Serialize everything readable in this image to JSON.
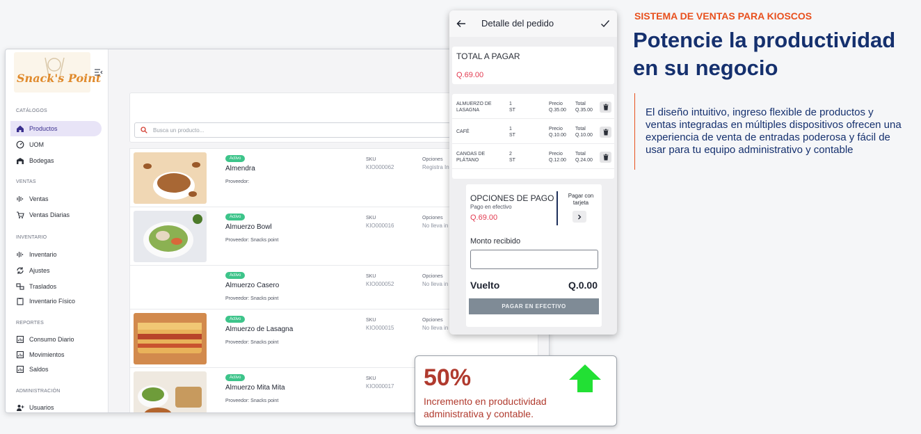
{
  "marketing": {
    "eyebrow": "SISTEMA DE VENTAS PARA KIOSCOS",
    "headline": "Potencie la productividad en su negocio",
    "description": "El diseño intuitivo, ingreso flexible de productos y ventas integradas en múltiples dispositivos ofrecen una experiencia de venta de entradas poderosa y fácil de usar para tu equipo administrativo y contable"
  },
  "app": {
    "logo_text": "Snack's Point",
    "sidebar": {
      "sections": [
        {
          "title": "CATÁLOGOS",
          "items": [
            {
              "label": "Productos",
              "icon": "home-icon",
              "active": true
            },
            {
              "label": "UOM",
              "icon": "gauge-icon"
            },
            {
              "label": "Bodegas",
              "icon": "warehouse-icon"
            }
          ]
        },
        {
          "title": "VENTAS",
          "items": [
            {
              "label": "Ventas",
              "icon": "bars-icon"
            },
            {
              "label": "Ventas Diarias",
              "icon": "cart-icon"
            }
          ]
        },
        {
          "title": "INVENTARIO",
          "items": [
            {
              "label": "Inventario",
              "icon": "bars-icon"
            },
            {
              "label": "Ajustes",
              "icon": "sync-icon"
            },
            {
              "label": "Traslados",
              "icon": "transfer-icon"
            },
            {
              "label": "Inventario Físico",
              "icon": "clipboard-icon"
            }
          ]
        },
        {
          "title": "REPORTES",
          "items": [
            {
              "label": "Consumo Diario",
              "icon": "report-icon"
            },
            {
              "label": "Movimientos",
              "icon": "report-icon"
            },
            {
              "label": "Saldos",
              "icon": "report-icon"
            }
          ]
        },
        {
          "title": "ADMINISTRACIÓN",
          "items": [
            {
              "label": "Usuarios",
              "icon": "add-user-icon"
            }
          ]
        }
      ]
    },
    "search": {
      "placeholder": "Busca un producto..."
    },
    "products": [
      {
        "status": "Activo",
        "name": "Almendra",
        "provider": "Proveedor:",
        "sku_label": "SKU",
        "sku": "KIO000062",
        "options_label": "Opciones",
        "options": "Registra In",
        "image": "almonds"
      },
      {
        "status": "Activo",
        "name": "Almuerzo Bowl",
        "provider": "Proveedor: Snacks point",
        "sku_label": "SKU",
        "sku": "KIO000016",
        "options_label": "Opciones",
        "options": "No lleva in",
        "image": "bowl"
      },
      {
        "status": "Activo",
        "name": "Almuerzo Casero",
        "provider": "Proveedor: Snacks point",
        "sku_label": "SKU",
        "sku": "KIO000052",
        "options_label": "Opciones",
        "options": "No lleva in",
        "image": ""
      },
      {
        "status": "Activo",
        "name": "Almuerzo de Lasagna",
        "provider": "Proveedor: Snacks point",
        "sku_label": "SKU",
        "sku": "KIO000015",
        "options_label": "Opciones",
        "options": "No lleva in",
        "image": "lasagna"
      },
      {
        "status": "Activo",
        "name": "Almuerzo Mita Mita",
        "provider": "Proveedor: Snacks point",
        "sku_label": "SKU",
        "sku": "KIO000017",
        "options_label": "",
        "options": "",
        "image": "salad"
      }
    ]
  },
  "order": {
    "title": "Detalle del pedido",
    "total_label": "TOTAL A PAGAR",
    "total_value": "Q.69.00",
    "items": [
      {
        "name_l1": "ALMUERZO DE",
        "name_l2": "LASAGNA",
        "qty": "1",
        "unit": "ST",
        "price_label": "Precio",
        "price": "Q.35.00",
        "total_label": "Total",
        "total": "Q.35.00"
      },
      {
        "name_l1": "CAFÉ",
        "name_l2": "",
        "qty": "1",
        "unit": "ST",
        "price_label": "Precio",
        "price": "Q.10.00",
        "total_label": "Total",
        "total": "Q.10.00"
      },
      {
        "name_l1": "CANOAS DE",
        "name_l2": "PLÁTANO",
        "qty": "2",
        "unit": "ST",
        "price_label": "Precio",
        "price": "Q.12.00",
        "total_label": "Total",
        "total": "Q.24.00"
      }
    ],
    "payment": {
      "title": "OPCIONES DE PAGO",
      "subtitle": "Pago en efectivo",
      "amount": "Q.69.00",
      "card_label_l1": "Pagar con",
      "card_label_l2": "tarjeta",
      "received_label": "Monto recibido",
      "received_value": "",
      "change_label": "Vuelto",
      "change_value": "Q.0.00",
      "pay_button": "PAGAR EN EFECTIVO"
    }
  },
  "stat": {
    "value": "50%",
    "description": "Incremento en productividad administrativa y contable."
  },
  "colors": {
    "accent_orange": "#e8501e",
    "navy": "#15306e",
    "active_badge": "#3dc48a",
    "price_red": "#e2394f",
    "arrow_green": "#22e034"
  }
}
